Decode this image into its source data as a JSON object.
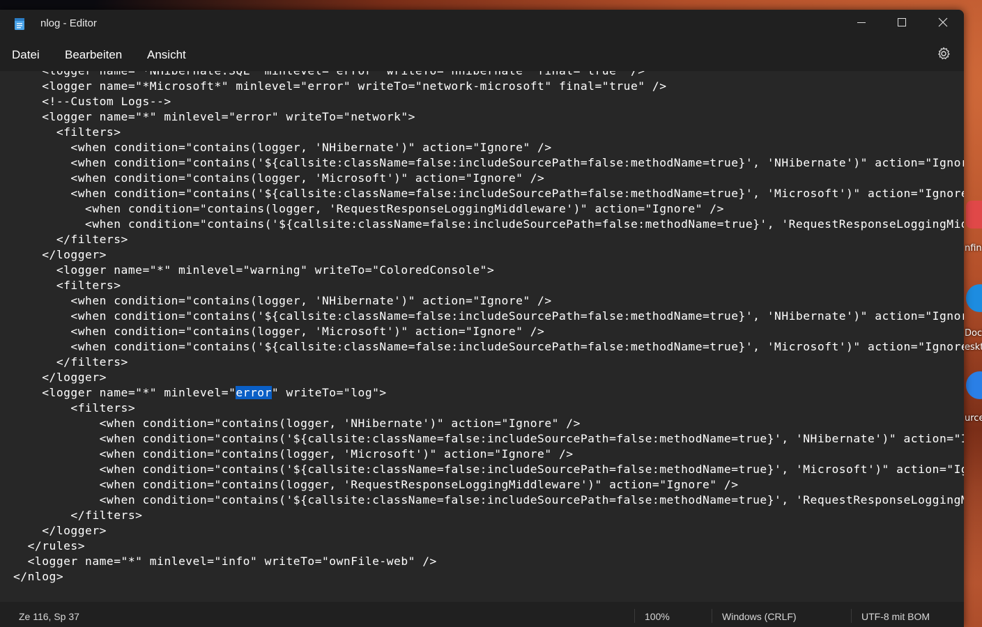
{
  "window": {
    "title": "nlog - Editor"
  },
  "menu": {
    "items": [
      "Datei",
      "Bearbeiten",
      "Ansicht"
    ]
  },
  "desktop": {
    "icon_labels": [
      "nfinc",
      "Dock",
      "eskt",
      "urce"
    ]
  },
  "editor": {
    "lines": [
      "    <logger name=\"*NHibernate.SQL\" minlevel=\"error\" writeTo=\"nhibernate\" final=\"true\" />",
      "    <logger name=\"*Microsoft*\" minlevel=\"error\" writeTo=\"network-microsoft\" final=\"true\" />",
      "    <!--Custom Logs-->",
      "    <logger name=\"*\" minlevel=\"error\" writeTo=\"network\">",
      "      <filters>",
      "        <when condition=\"contains(logger, 'NHibernate')\" action=\"Ignore\" />",
      "        <when condition=\"contains('${callsite:className=false:includeSourcePath=false:methodName=true}', 'NHibernate')\" action=\"Ignore\"",
      "        <when condition=\"contains(logger, 'Microsoft')\" action=\"Ignore\" />",
      "        <when condition=\"contains('${callsite:className=false:includeSourcePath=false:methodName=true}', 'Microsoft')\" action=\"Ignore\"",
      "          <when condition=\"contains(logger, 'RequestResponseLoggingMiddleware')\" action=\"Ignore\" />",
      "          <when condition=\"contains('${callsite:className=false:includeSourcePath=false:methodName=true}', 'RequestResponseLoggingMidd",
      "      </filters>",
      "    </logger>",
      "      <logger name=\"*\" minlevel=\"warning\" writeTo=\"ColoredConsole\">",
      "      <filters>",
      "        <when condition=\"contains(logger, 'NHibernate')\" action=\"Ignore\" />",
      "        <when condition=\"contains('${callsite:className=false:includeSourcePath=false:methodName=true}', 'NHibernate')\" action=\"Ignore\"",
      "        <when condition=\"contains(logger, 'Microsoft')\" action=\"Ignore\" />",
      "        <when condition=\"contains('${callsite:className=false:includeSourcePath=false:methodName=true}', 'Microsoft')\" action=\"Ignore\"",
      "      </filters>",
      "    </logger>",
      "    <logger name=\"*\" minlevel=\"error\" writeTo=\"log\">",
      "        <filters>",
      "            <when condition=\"contains(logger, 'NHibernate')\" action=\"Ignore\" />",
      "            <when condition=\"contains('${callsite:className=false:includeSourcePath=false:methodName=true}', 'NHibernate')\" action=\"Ig",
      "            <when condition=\"contains(logger, 'Microsoft')\" action=\"Ignore\" />",
      "            <when condition=\"contains('${callsite:className=false:includeSourcePath=false:methodName=true}', 'Microsoft')\" action=\"Ign",
      "            <when condition=\"contains(logger, 'RequestResponseLoggingMiddleware')\" action=\"Ignore\" />",
      "            <when condition=\"contains('${callsite:className=false:includeSourcePath=false:methodName=true}', 'RequestResponseLoggingMi",
      "        </filters>",
      "    </logger>",
      "  </rules>",
      "  <logger name=\"*\" minlevel=\"info\" writeTo=\"ownFile-web\" />",
      "</nlog>"
    ],
    "selected_line": 21,
    "selected_text": "error"
  },
  "status": {
    "position": "Ze 116, Sp 37",
    "zoom": "100%",
    "line_ending": "Windows (CRLF)",
    "encoding": "UTF-8 mit BOM"
  }
}
